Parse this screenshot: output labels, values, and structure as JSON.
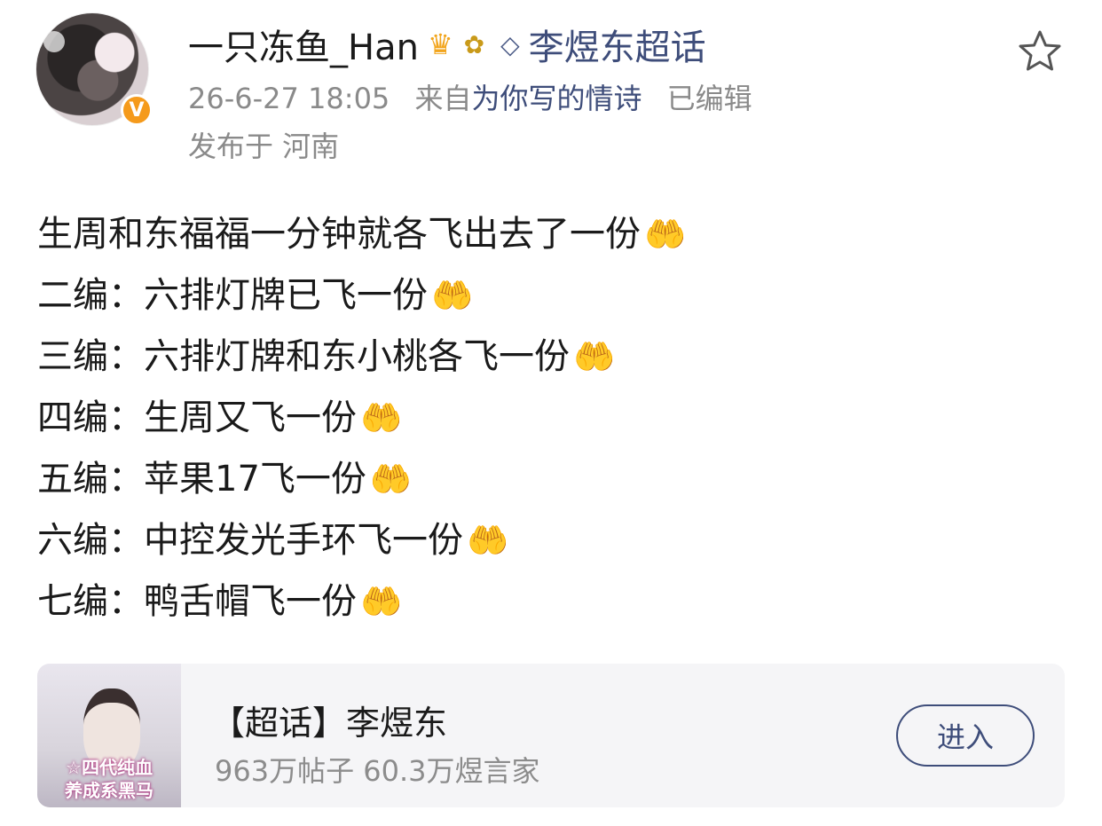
{
  "author": {
    "name": "一只冻鱼_Han",
    "verified_badge": "V",
    "crown_icon": "crown-icon",
    "bouquet_icon": "bouquet-icon"
  },
  "supertopic": {
    "icon": "diamond-icon",
    "label": "李煜东超话"
  },
  "meta": {
    "timestamp": "26-6-27 18:05",
    "source_prefix": "来自",
    "source": "为你写的情诗",
    "edited": "已编辑",
    "location": "发布于 河南"
  },
  "post": {
    "lines": [
      "生周和东福福一分钟就各飞出去了一份",
      "二编：六排灯牌已飞一份",
      "三编：六排灯牌和东小桃各飞一份",
      "四编：生周又飞一份",
      "五编：苹果17飞一份",
      "六编：中控发光手环飞一份",
      "七编：鸭舌帽飞一份"
    ],
    "emoji": "🤲"
  },
  "card": {
    "title": "【超话】李煜东",
    "subtitle": "963万帖子 60.3万煜言家",
    "thumb_text_1": "☆四代纯血",
    "thumb_text_2": "养成系黑马",
    "button": "进入"
  },
  "colors": {
    "link": "#3e4d7a",
    "meta": "#8a8a8a",
    "badge": "#f59a1b",
    "card_bg": "#f5f5f7"
  }
}
